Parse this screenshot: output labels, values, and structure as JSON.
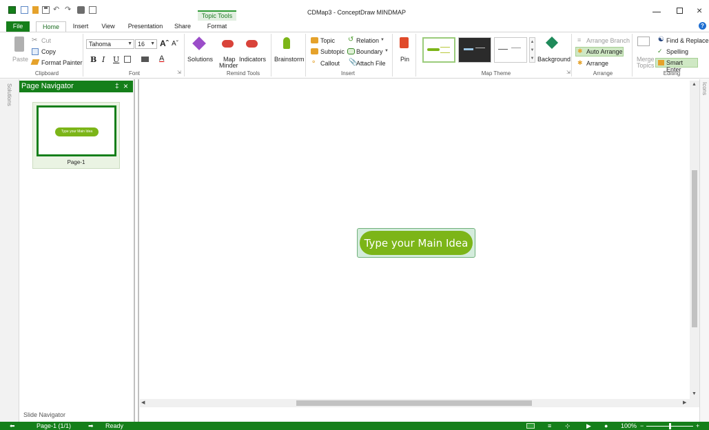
{
  "window": {
    "title": "CDMap3 - ConceptDraw MINDMAP",
    "contextual_tab": "Topic Tools"
  },
  "tabs": [
    "File",
    "Home",
    "Insert",
    "View",
    "Presentation",
    "Share",
    "Format"
  ],
  "ribbon": {
    "clipboard": {
      "paste": "Paste",
      "cut": "Cut",
      "copy": "Copy",
      "format_painter": "Format Painter",
      "label": "Clipboard"
    },
    "font": {
      "family": "Tahoma",
      "size": "16",
      "bold": "B",
      "italic": "I",
      "underline": "U",
      "label": "Font"
    },
    "remind": {
      "solutions": "Solutions",
      "map_minder_1": "Map",
      "map_minder_2": "Minder",
      "indicators": "Indicators",
      "label": "Remind Tools"
    },
    "brainstorm": "Brainstorm",
    "insert": {
      "topic": "Topic",
      "subtopic": "Subtopic",
      "callout": "Callout",
      "relation": "Relation",
      "boundary": "Boundary",
      "attach_file": "Attach File",
      "label": "Insert"
    },
    "pin": "Pin",
    "theme": {
      "label": "Map Theme",
      "background": "Background"
    },
    "arrange": {
      "arrange_branch": "Arrange Branch",
      "auto_arrange": "Auto Arrange",
      "arrange": "Arrange",
      "label": "Arrange"
    },
    "editing": {
      "merge_1": "Merge",
      "merge_2": "Topics",
      "find_replace": "Find & Replace",
      "spelling": "Spelling",
      "smart_enter": "Smart Enter",
      "label": "Editing"
    }
  },
  "side_panels": {
    "left_tab": "Solutions",
    "right_tab": "Icons"
  },
  "navigator": {
    "title": "Page Navigator",
    "pin": "‡",
    "close": "×",
    "thumb_text": "Type your Main Idea",
    "page_label": "Page-1",
    "footer": "Slide Navigator"
  },
  "canvas": {
    "main_idea": "Type your Main Idea"
  },
  "status": {
    "page": "Page-1 (1/1)",
    "state": "Ready",
    "zoom": "100%"
  },
  "colors": {
    "brand_green": "#157f1a",
    "topic_green": "#7cb518",
    "accent_blue": "#1f6fd1"
  }
}
